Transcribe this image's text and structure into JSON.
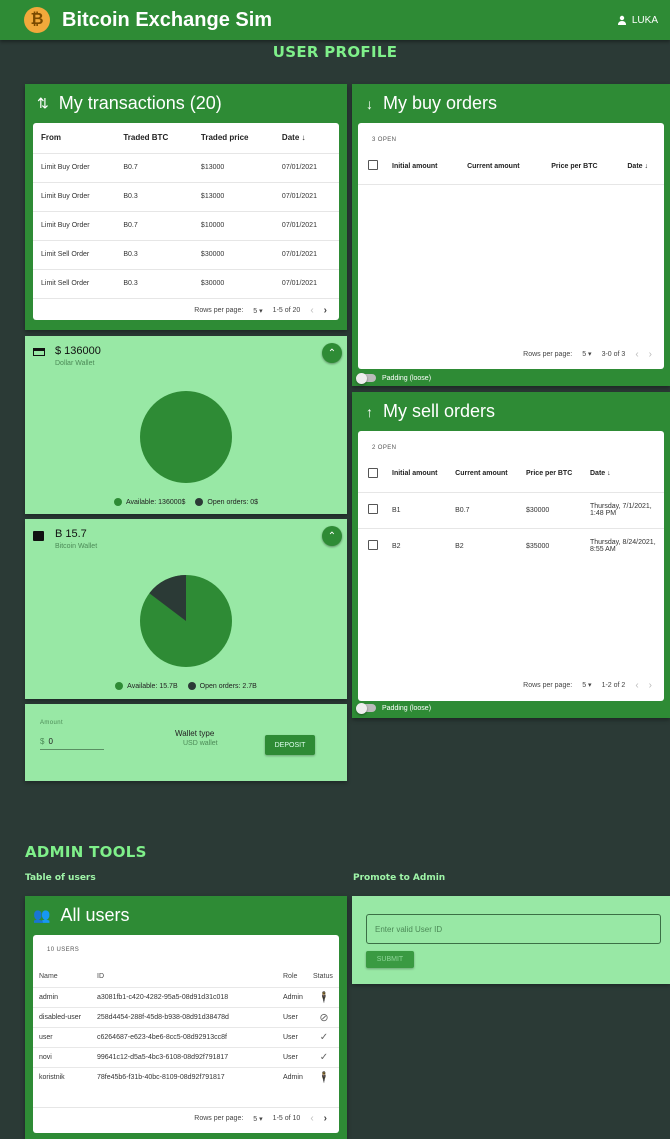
{
  "app": {
    "title": "Bitcoin Exchange Sim",
    "logo_glyph": "₿",
    "user": "LUKA"
  },
  "page_title": "USER PROFILE",
  "transactions": {
    "title": "My transactions (20)",
    "headers": [
      "From",
      "Traded BTC",
      "Traded price",
      "Date ↓"
    ],
    "rows": [
      [
        "Limit Buy Order",
        "B0.7",
        "$13000",
        "07/01/2021"
      ],
      [
        "Limit Buy Order",
        "B0.3",
        "$13000",
        "07/01/2021"
      ],
      [
        "Limit Buy Order",
        "B0.7",
        "$10000",
        "07/01/2021"
      ],
      [
        "Limit Sell Order",
        "B0.3",
        "$30000",
        "07/01/2021"
      ],
      [
        "Limit Sell Order",
        "B0.3",
        "$30000",
        "07/01/2021"
      ]
    ],
    "rows_per_page_label": "Rows per page:",
    "rows_per_page": "5",
    "range": "1-5 of 20"
  },
  "dollar_wallet": {
    "amount": "$ 136000",
    "label": "Dollar Wallet",
    "legend_available": "Available: 136000$",
    "legend_open": "Open orders: 0$",
    "available_fraction": 1.0
  },
  "bitcoin_wallet": {
    "amount": "B 15.7",
    "label": "Bitcoin Wallet",
    "legend_available": "Available: 15.7B",
    "legend_open": "Open orders: 2.7B",
    "available": 15.7,
    "open": 2.7
  },
  "deposit": {
    "amount_label": "Amount",
    "currency": "$",
    "amount_value": "0",
    "wallet_type_label": "Wallet type",
    "wallet_type_value": "USD wallet",
    "button": "DEPOSIT"
  },
  "buy_orders": {
    "title": "My buy orders",
    "open_count": "3 OPEN",
    "headers": [
      "Initial amount",
      "Current amount",
      "Price per BTC",
      "Date ↓"
    ],
    "rows_per_page_label": "Rows per page:",
    "rows_per_page": "5",
    "range": "3-0 of 3",
    "padding_label": "Padding (loose)"
  },
  "sell_orders": {
    "title": "My sell orders",
    "open_count": "2 OPEN",
    "headers": [
      "Initial amount",
      "Current amount",
      "Price per BTC",
      "Date ↓"
    ],
    "rows": [
      [
        "B1",
        "B0.7",
        "$30000",
        "Thursday, 7/1/2021, 1:48 PM"
      ],
      [
        "B2",
        "B2",
        "$35000",
        "Thursday, 8/24/2021, 8:55 AM"
      ]
    ],
    "rows_per_page_label": "Rows per page:",
    "rows_per_page": "5",
    "range": "1-2 of 2",
    "padding_label": "Padding (loose)"
  },
  "admin": {
    "title": "ADMIN TOOLS",
    "table_label": "Table of users",
    "promote_label": "Promote to Admin",
    "all_users_title": "All users",
    "users_count": "10 USERS",
    "headers": [
      "Name",
      "ID",
      "Role",
      "Status"
    ],
    "rows": [
      {
        "name": "admin",
        "id": "a3081fb1-c420-4282-95a5-08d91d31c018",
        "role": "Admin",
        "status": "admin-icon"
      },
      {
        "name": "disabled-user",
        "id": "258d4454-288f-45d8-b938-08d91d38478d",
        "role": "User",
        "status": "disabled-icon"
      },
      {
        "name": "user",
        "id": "c6264687-e623-4be6-8cc5-08d92913cc8f",
        "role": "User",
        "status": "check-icon"
      },
      {
        "name": "novi",
        "id": "99641c12-d5a5-4bc3-6108-08d92f791817",
        "role": "User",
        "status": "check-icon"
      },
      {
        "name": "koristnik",
        "id": "78fe45b6-f31b-40bc-8109-08d92f791817",
        "role": "Admin",
        "status": "admin-icon"
      }
    ],
    "rows_per_page_label": "Rows per page:",
    "rows_per_page": "5",
    "range": "1-5 of 10",
    "promote_placeholder": "Enter valid User ID",
    "submit": "SUBMIT"
  },
  "colors": {
    "primary": "#2e8b35",
    "background": "#2b3a36",
    "light": "#98e8a5",
    "dark_slice": "#2b3a36",
    "accent_text": "#7ff08a"
  }
}
